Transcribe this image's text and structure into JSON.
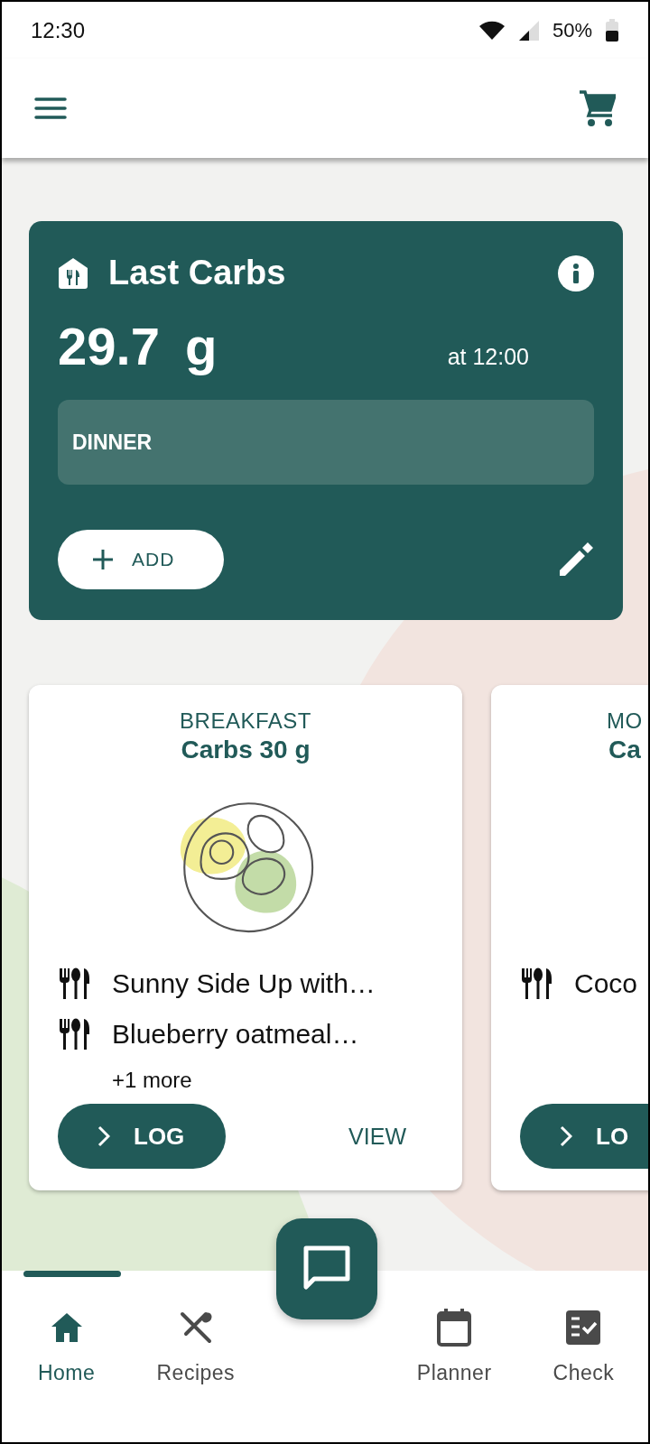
{
  "status_bar": {
    "time": "12:30",
    "battery": "50%"
  },
  "last_carbs": {
    "title": "Last Carbs",
    "amount": "29.7",
    "unit": "g",
    "time": "at 12:00",
    "meal": "DINNER",
    "add_button": "ADD"
  },
  "meal_cards": [
    {
      "kind": "full",
      "category": "BREAKFAST",
      "carbs": "Carbs 30 g",
      "items": [
        "Sunny Side Up with…",
        "Blueberry oatmeal…"
      ],
      "more": "+1 more",
      "log_button": "LOG",
      "view_button": "VIEW"
    },
    {
      "kind": "cut",
      "category": "MO",
      "carbs": "Ca",
      "items": [
        "Coco"
      ],
      "log_button": "LO"
    }
  ],
  "nav": [
    {
      "label": "Home",
      "selected": true
    },
    {
      "label": "Recipes",
      "selected": false
    },
    {
      "label": "Planner",
      "selected": false
    },
    {
      "label": "Check",
      "selected": false
    }
  ]
}
